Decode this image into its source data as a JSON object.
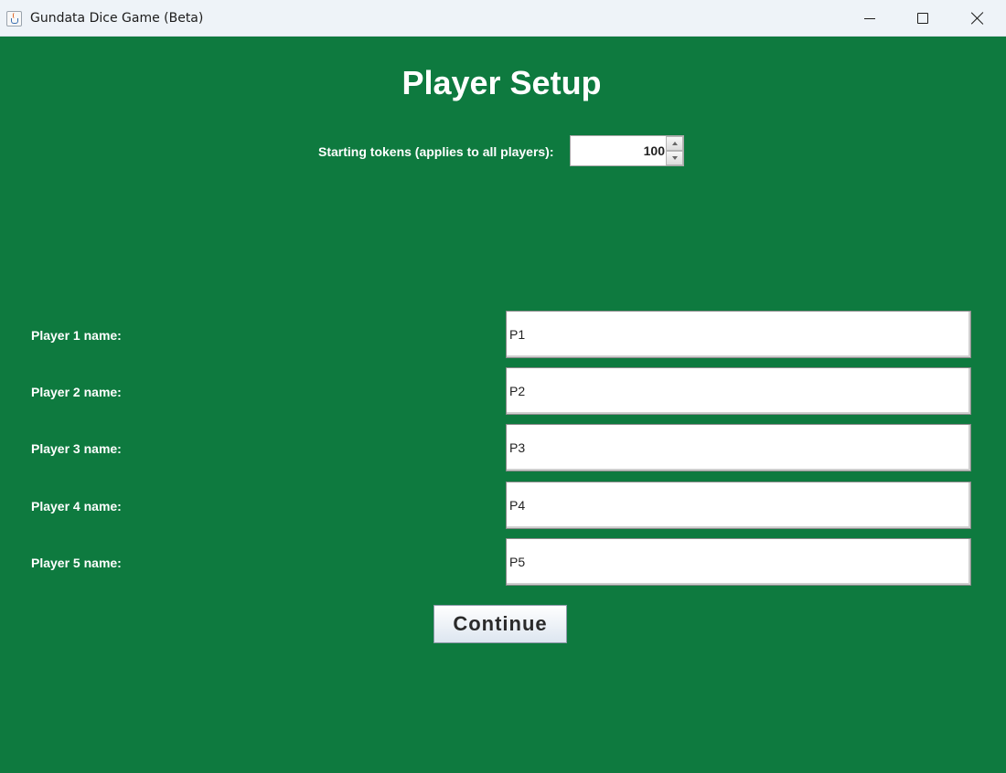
{
  "window": {
    "title": "Gundata Dice Game (Beta)"
  },
  "setup": {
    "heading": "Player Setup",
    "tokens_label": "Starting tokens (applies to all players):",
    "tokens_value": "100"
  },
  "players": [
    {
      "label": "Player 1 name:",
      "value": "P1"
    },
    {
      "label": "Player 2 name:",
      "value": "P2"
    },
    {
      "label": "Player 3 name:",
      "value": "P3"
    },
    {
      "label": "Player 4 name:",
      "value": "P4"
    },
    {
      "label": "Player 5 name:",
      "value": "P5"
    }
  ],
  "actions": {
    "continue_label": "Continue"
  },
  "colors": {
    "background": "#0e7a3f",
    "text": "#ffffff"
  }
}
